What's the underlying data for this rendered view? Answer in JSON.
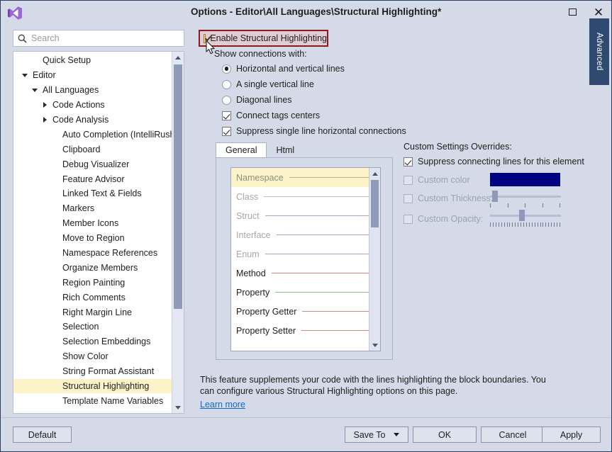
{
  "window": {
    "title": "Options - Editor\\All Languages\\Structural Highlighting*",
    "logo_icon": "visual-studio-logo",
    "maximize_icon": "maximize-icon",
    "close_icon": "close-icon",
    "side_tab_label": "Advanced"
  },
  "search": {
    "placeholder": "Search",
    "icon": "search-icon",
    "value": ""
  },
  "tree": {
    "items": [
      {
        "label": "Quick Setup",
        "indent": 1,
        "twisty": "none",
        "selected": false
      },
      {
        "label": "Editor",
        "indent": 0,
        "twisty": "expanded",
        "selected": false
      },
      {
        "label": "All Languages",
        "indent": 1,
        "twisty": "expanded",
        "selected": false
      },
      {
        "label": "Code Actions",
        "indent": 2,
        "twisty": "collapsed",
        "selected": false
      },
      {
        "label": "Code Analysis",
        "indent": 2,
        "twisty": "collapsed",
        "selected": false
      },
      {
        "label": "Auto Completion (IntelliRush)",
        "indent": 3,
        "twisty": "none",
        "selected": false
      },
      {
        "label": "Clipboard",
        "indent": 3,
        "twisty": "none",
        "selected": false
      },
      {
        "label": "Debug Visualizer",
        "indent": 3,
        "twisty": "none",
        "selected": false
      },
      {
        "label": "Feature Advisor",
        "indent": 3,
        "twisty": "none",
        "selected": false
      },
      {
        "label": "Linked Text & Fields",
        "indent": 3,
        "twisty": "none",
        "selected": false
      },
      {
        "label": "Markers",
        "indent": 3,
        "twisty": "none",
        "selected": false
      },
      {
        "label": "Member Icons",
        "indent": 3,
        "twisty": "none",
        "selected": false
      },
      {
        "label": "Move to Region",
        "indent": 3,
        "twisty": "none",
        "selected": false
      },
      {
        "label": "Namespace References",
        "indent": 3,
        "twisty": "none",
        "selected": false
      },
      {
        "label": "Organize Members",
        "indent": 3,
        "twisty": "none",
        "selected": false
      },
      {
        "label": "Region Painting",
        "indent": 3,
        "twisty": "none",
        "selected": false
      },
      {
        "label": "Rich Comments",
        "indent": 3,
        "twisty": "none",
        "selected": false
      },
      {
        "label": "Right Margin Line",
        "indent": 3,
        "twisty": "none",
        "selected": false
      },
      {
        "label": "Selection",
        "indent": 3,
        "twisty": "none",
        "selected": false
      },
      {
        "label": "Selection Embeddings",
        "indent": 3,
        "twisty": "none",
        "selected": false
      },
      {
        "label": "Show Color",
        "indent": 3,
        "twisty": "none",
        "selected": false
      },
      {
        "label": "String Format Assistant",
        "indent": 3,
        "twisty": "none",
        "selected": false
      },
      {
        "label": "Structural Highlighting",
        "indent": 3,
        "twisty": "none",
        "selected": true
      },
      {
        "label": "Template Name Variables",
        "indent": 3,
        "twisty": "none",
        "selected": false
      }
    ],
    "scroll_up_icon": "scroll-up-arrow-icon",
    "scroll_down_icon": "scroll-down-arrow-icon"
  },
  "options": {
    "enable_label": "Enable Structural Highlighting",
    "enable_checked": true,
    "show_connections_label": "Show connections with:",
    "radios": [
      {
        "label": "Horizontal and vertical lines",
        "checked": true
      },
      {
        "label": "A single vertical line",
        "checked": false
      },
      {
        "label": "Diagonal lines",
        "checked": false
      }
    ],
    "checkboxes": [
      {
        "label": "Connect tags centers",
        "checked": true
      },
      {
        "label": "Suppress single line horizontal connections",
        "checked": true
      }
    ]
  },
  "tabs": [
    {
      "label": "General",
      "active": true
    },
    {
      "label": "Html",
      "active": false
    }
  ],
  "preview": {
    "rows": [
      {
        "name": "Namespace",
        "name_color": "#8d8d82",
        "line_color": "#b9b48a",
        "highlight": true
      },
      {
        "name": "Class",
        "name_color": "#a8a8a8",
        "line_color": "#b9bfd4",
        "highlight": false
      },
      {
        "name": "Struct",
        "name_color": "#a8a8a8",
        "line_color": "#9fa9c6",
        "highlight": false
      },
      {
        "name": "Interface",
        "name_color": "#a8a8a8",
        "line_color": "#9fa9c6",
        "highlight": false
      },
      {
        "name": "Enum",
        "name_color": "#a8a8a8",
        "line_color": "#9fa9c6",
        "highlight": false
      },
      {
        "name": "Method",
        "name_color": "#1e1e1e",
        "line_color": "#c98b86",
        "highlight": false
      },
      {
        "name": "Property",
        "name_color": "#1e1e1e",
        "line_color": "#8fbb8c",
        "highlight": false
      },
      {
        "name": "Property Getter",
        "name_color": "#1e1e1e",
        "line_color": "#c98b86",
        "highlight": false
      },
      {
        "name": "Property Setter",
        "name_color": "#1e1e1e",
        "line_color": "#c98b86",
        "highlight": false
      }
    ],
    "scroll_up_icon": "scroll-up-arrow-icon",
    "scroll_down_icon": "scroll-down-arrow-icon"
  },
  "overrides": {
    "title": "Custom Settings Overrides:",
    "suppress_label": "Suppress connecting lines for this element",
    "suppress_checked": true,
    "custom_color": {
      "label": "Custom color",
      "checked": false,
      "enabled": false,
      "swatch_hex": "#000080"
    },
    "custom_thickness": {
      "label": "Custom Thickness:",
      "checked": false,
      "enabled": false,
      "value_percent": 3,
      "tick_count": 5
    },
    "custom_opacity": {
      "label": "Custom Opacity:",
      "checked": false,
      "enabled": false,
      "value_percent": 45,
      "tick_count": 26
    }
  },
  "description": {
    "text": "This feature supplements your code with the lines highlighting the block boundaries. You can configure various Structural Highlighting options on this page.",
    "link_label": "Learn more"
  },
  "footer": {
    "default_label": "Default",
    "save_to_label": "Save To",
    "ok_label": "OK",
    "cancel_label": "Cancel",
    "apply_label": "Apply"
  },
  "colors": {
    "dialog_bg": "#d4dae8",
    "accent_red": "#8b1a1a",
    "highlight_yellow": "#fdf3c8",
    "link_blue": "#1569c7",
    "advanced_tab_bg": "#2f4a70"
  }
}
